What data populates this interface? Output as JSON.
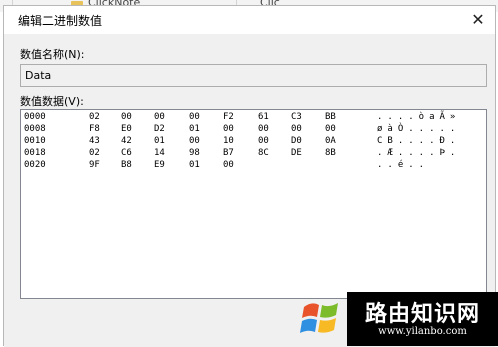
{
  "background": {
    "folder_item": "ClickNote",
    "right_item": "Clic"
  },
  "dialog": {
    "title": "编辑二进制数值",
    "close_glyph": "✕",
    "value_name_label": "数值名称(N):",
    "value_name": "Data",
    "value_data_label": "数值数据(V):",
    "rows": [
      {
        "addr": "0000",
        "bytes": [
          "02",
          "00",
          "00",
          "00",
          "F2",
          "61",
          "C3",
          "BB"
        ],
        "ascii": "....òaÃ»"
      },
      {
        "addr": "0008",
        "bytes": [
          "F8",
          "E0",
          "D2",
          "01",
          "00",
          "00",
          "00",
          "00"
        ],
        "ascii": "øàÒ....."
      },
      {
        "addr": "0010",
        "bytes": [
          "43",
          "42",
          "01",
          "00",
          "10",
          "00",
          "D0",
          "0A"
        ],
        "ascii": "CB....Ð."
      },
      {
        "addr": "0018",
        "bytes": [
          "02",
          "C6",
          "14",
          "98",
          "B7",
          "8C",
          "DE",
          "8B"
        ],
        "ascii": ".Æ....Þ."
      },
      {
        "addr": "0020",
        "bytes": [
          "9F",
          "B8",
          "E9",
          "01",
          "00"
        ],
        "ascii": "..é.."
      }
    ]
  },
  "watermark": {
    "title": "路由知识网",
    "url": "www.yilanbo.com"
  },
  "colors": {
    "dialog_bg": "#f0f0f0",
    "title_bg": "#ffffff",
    "watermark_bg": "#000000"
  }
}
